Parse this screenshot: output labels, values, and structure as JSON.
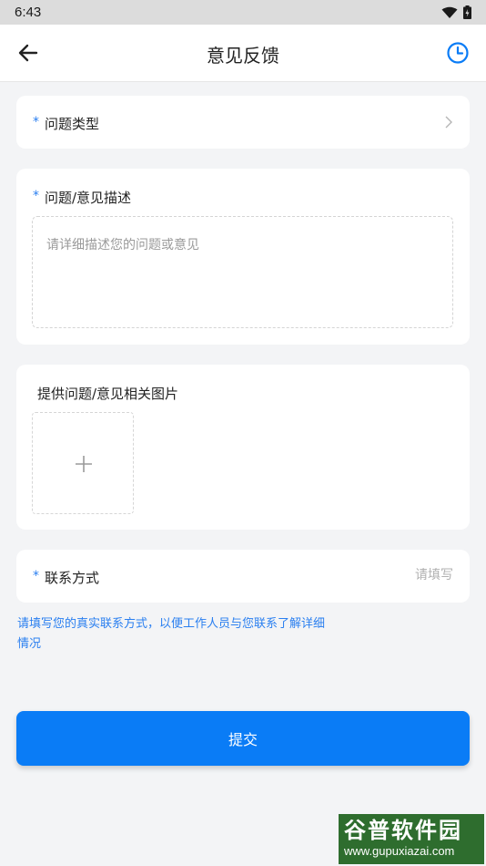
{
  "status_bar": {
    "time": "6:43",
    "icons": [
      "wifi-icon",
      "battery-icon"
    ]
  },
  "header": {
    "title": "意见反馈",
    "back_icon": "arrow-left-icon",
    "history_icon": "clock-icon"
  },
  "form": {
    "required_mark": "*",
    "problem_type": {
      "label": "问题类型"
    },
    "description": {
      "label": "问题/意见描述",
      "placeholder": "请详细描述您的问题或意见"
    },
    "images": {
      "label": "提供问题/意见相关图片"
    },
    "contact": {
      "label": "联系方式",
      "placeholder": "请填写"
    },
    "hint": "请填写您的真实联系方式，以便工作人员与您联系了解详细情况"
  },
  "submit": {
    "label": "提交"
  },
  "watermark": {
    "title": "谷普软件园",
    "url": "www.gupuxiazai.com"
  },
  "colors": {
    "accent": "#0a7cf6",
    "background": "#f3f4f6",
    "watermark_bg": "#2e6d2e"
  }
}
